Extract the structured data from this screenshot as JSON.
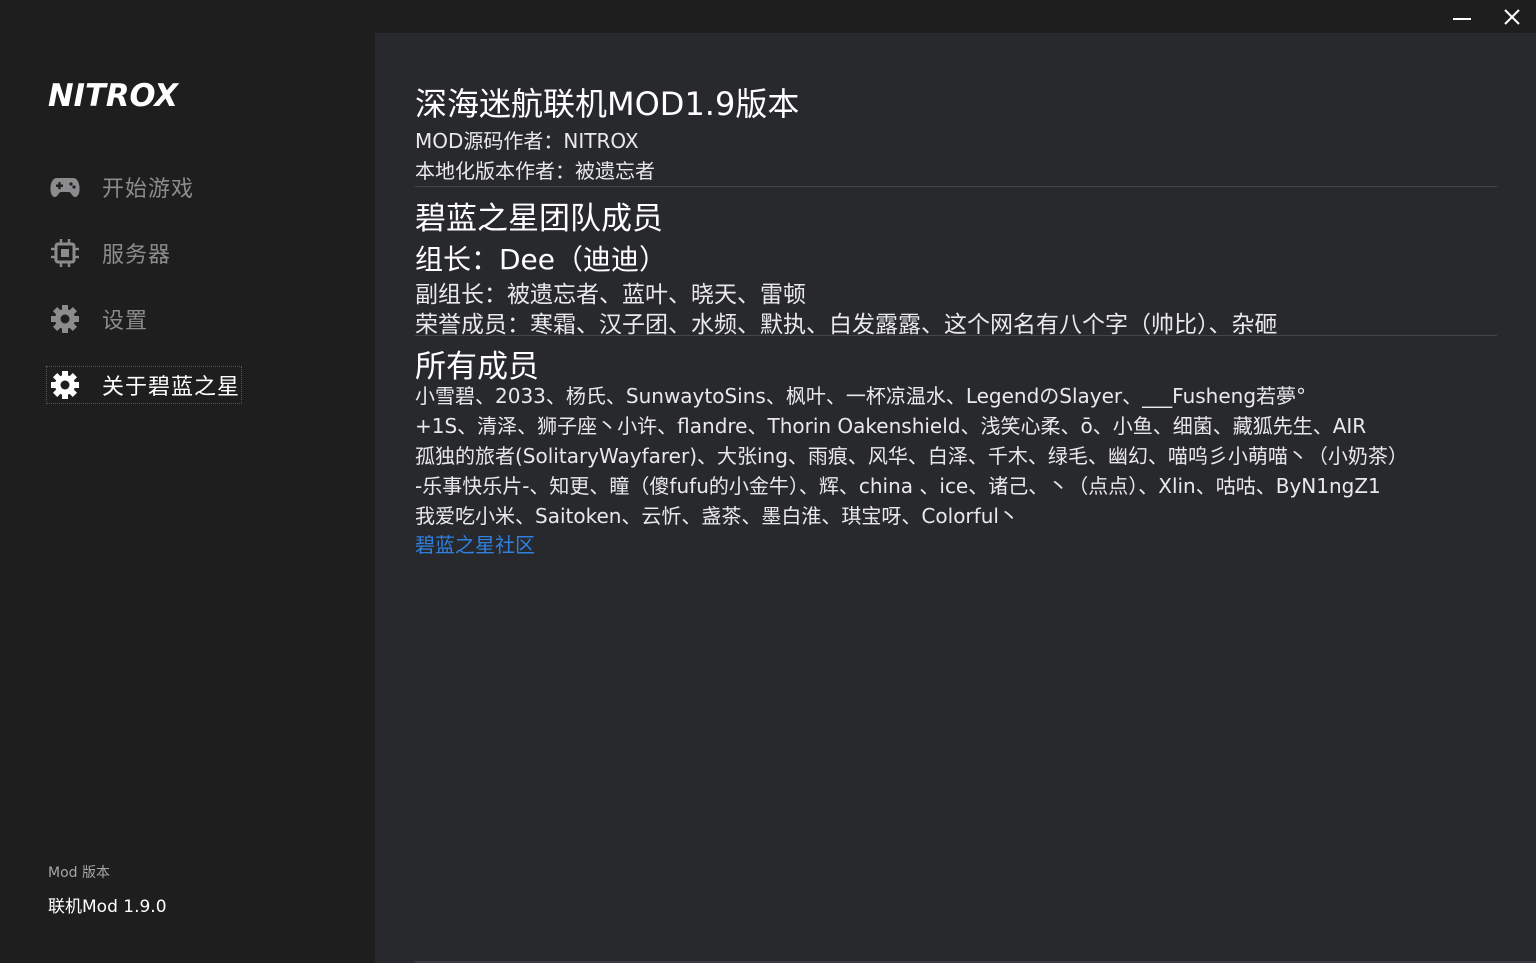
{
  "window": {
    "minimize_icon": "minimize-icon",
    "close_icon": "close-icon"
  },
  "sidebar": {
    "logo_text": "NITROX",
    "items": [
      {
        "label": "开始游戏",
        "icon": "gamepad-icon"
      },
      {
        "label": "服务器",
        "icon": "chip-icon"
      },
      {
        "label": "设置",
        "icon": "gear-icon"
      },
      {
        "label": "关于碧蓝之星",
        "icon": "gear-icon",
        "active": true
      }
    ],
    "version_caption": "Mod 版本",
    "version_value": "联机Mod 1.9.0"
  },
  "main": {
    "title": "深海迷航联机MOD1.9版本",
    "source_author": "MOD源码作者：NITROX",
    "localization_author": "本地化版本作者：被遗忘者",
    "team_heading": "碧蓝之星团队成员",
    "leader": "组长：Dee（迪迪）",
    "vice_leaders": "副组长：被遗忘者、蓝叶、晓天、雷顿",
    "honor_members": "荣誉成员：寒霜、汉子团、水频、默执、白发露露、这个网名有八个字（帅比）、杂砸",
    "members_heading": "所有成员",
    "members_lines": [
      "小雪碧、2033、杨氏、SunwaytoSins、枫叶、一杯凉温水、LegendのSlayer、___Fusheng若夢°",
      "+1S、清泽、狮子座丶小许、flandre、Thorin Oakenshield、浅笑心柔、ō、小鱼、细菌、藏狐先生、AIR",
      "孤独的旅者(SolitaryWayfarer)、大张ing、雨痕、风华、白泽、千木、绿毛、幽幻、喵呜彡小萌喵丶（小奶茶）",
      "-乐事快乐片-、知更、瞳（傻fufu的小金牛）、辉、china 、ice、诸己、丶（点点）、Xlin、咕咕、ByN1ngZ1",
      "我爱吃小米、Saitoken、云忻、盏茶、墨白淮、琪宝呀、Colorful丶"
    ],
    "community_link": "碧蓝之星社区"
  },
  "colors": {
    "sidebar_bg": "#1e1e1f",
    "main_bg": "#28292c",
    "link": "#2f7fe0",
    "nav_inactive": "#8c8c8e",
    "nav_active": "#ffffff"
  }
}
